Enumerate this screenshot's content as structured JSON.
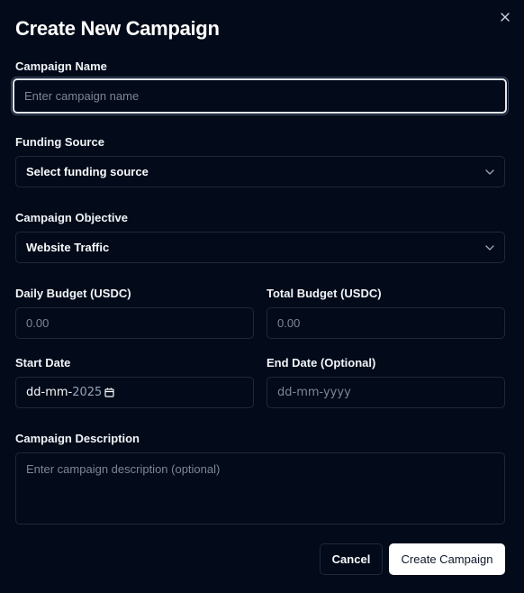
{
  "dialog": {
    "title": "Create New Campaign"
  },
  "form": {
    "campaign_name": {
      "label": "Campaign Name",
      "value": "",
      "placeholder": "Enter campaign name"
    },
    "funding_source": {
      "label": "Funding Source",
      "selected": "Select funding source"
    },
    "objective": {
      "label": "Campaign Objective",
      "selected": "Website Traffic"
    },
    "daily_budget": {
      "label": "Daily Budget (USDC)",
      "value": "",
      "placeholder": "0.00"
    },
    "total_budget": {
      "label": "Total Budget (USDC)",
      "value": "",
      "placeholder": "0.00"
    },
    "start_date": {
      "label": "Start Date",
      "display_dd_mm": "dd-mm-",
      "display_year": "2025"
    },
    "end_date": {
      "label": "End Date (Optional)",
      "placeholder": "dd-mm-yyyy"
    },
    "description": {
      "label": "Campaign Description",
      "value": "",
      "placeholder": "Enter campaign description (optional)"
    }
  },
  "actions": {
    "cancel_label": "Cancel",
    "create_label": "Create Campaign"
  },
  "icons": {
    "close": "close-icon",
    "chevron": "chevron-down-icon",
    "calendar": "calendar-icon"
  },
  "colors": {
    "background": "#030a19",
    "border": "#1e293b",
    "placeholder": "#7b8797",
    "primary_button": "#ffffff"
  }
}
